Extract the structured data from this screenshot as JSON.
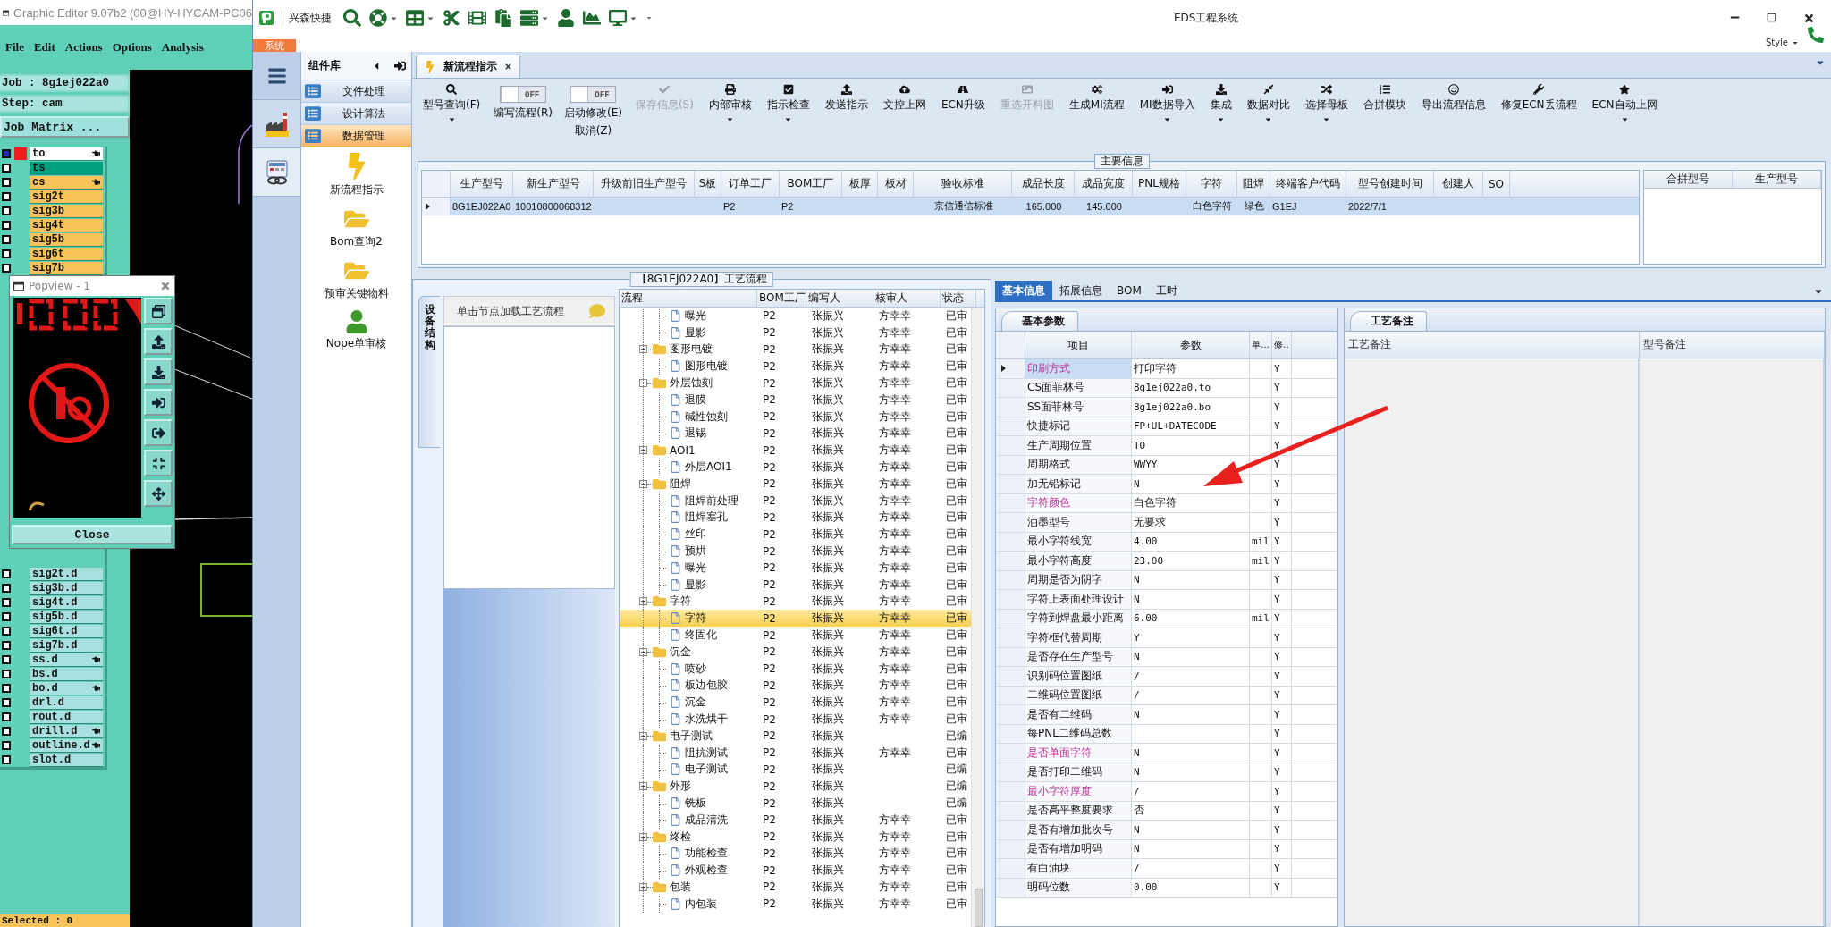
{
  "graphic_editor": {
    "title": "Graphic Editor 9.07b2 (00@HY-HYCAM-PC06",
    "menu": [
      "File",
      "Edit",
      "Actions",
      "Options",
      "Analysis"
    ],
    "job": "Job : 8g1ej022a0",
    "step": "Step: cam",
    "job_matrix_button": "Job Matrix ...",
    "layers_upper": [
      {
        "name": "to",
        "color": "#ffffff",
        "active": true,
        "marked": true
      },
      {
        "name": "ts",
        "color": "#00a07c",
        "active": false,
        "marked": false
      },
      {
        "name": "cs",
        "color": "#f8c25a",
        "active": false,
        "marked": true
      },
      {
        "name": "sig2t",
        "color": "#f8c25a",
        "active": false,
        "marked": false
      },
      {
        "name": "sig3b",
        "color": "#f8c25a",
        "active": false,
        "marked": false
      },
      {
        "name": "sig4t",
        "color": "#f8c25a",
        "active": false,
        "marked": false
      },
      {
        "name": "sig5b",
        "color": "#f8c25a",
        "active": false,
        "marked": false
      },
      {
        "name": "sig6t",
        "color": "#f8c25a",
        "active": false,
        "marked": false
      },
      {
        "name": "sig7b",
        "color": "#f8c25a",
        "active": false,
        "marked": false
      }
    ],
    "layers_lower": [
      {
        "name": "sig2t.d",
        "color": "#a8e0e0",
        "active": false,
        "marked": false
      },
      {
        "name": "sig3b.d",
        "color": "#a8e0e0",
        "active": false,
        "marked": false
      },
      {
        "name": "sig4t.d",
        "color": "#a8e0e0",
        "active": false,
        "marked": false
      },
      {
        "name": "sig5b.d",
        "color": "#a8e0e0",
        "active": false,
        "marked": false
      },
      {
        "name": "sig6t.d",
        "color": "#a8e0e0",
        "active": false,
        "marked": false
      },
      {
        "name": "sig7b.d",
        "color": "#a8e0e0",
        "active": false,
        "marked": false
      },
      {
        "name": "ss.d",
        "color": "#a8e0e0",
        "active": false,
        "marked": true
      },
      {
        "name": "bs.d",
        "color": "#a8e0e0",
        "active": false,
        "marked": false
      },
      {
        "name": "bo.d",
        "color": "#a8e0e0",
        "active": false,
        "marked": true
      },
      {
        "name": "drl.d",
        "color": "#a8e0e0",
        "active": false,
        "marked": false
      },
      {
        "name": "rout.d",
        "color": "#a8e0e0",
        "active": false,
        "marked": false
      },
      {
        "name": "drill.d",
        "color": "#a8e0e0",
        "active": false,
        "marked": true
      },
      {
        "name": "outline.d",
        "color": "#a8e0e0",
        "active": false,
        "marked": true
      },
      {
        "name": "slot.d",
        "color": "#a8e0e0",
        "active": false,
        "marked": false
      }
    ],
    "status": "Selected : 0",
    "popview": {
      "title": "Popview - 1",
      "close_button": "Close"
    }
  },
  "eds": {
    "app_name": "兴森快捷",
    "title": "EDS工程系统",
    "system_tab": "系统",
    "style_menu": "Style",
    "component_library": {
      "title": "组件库",
      "categories": [
        {
          "label": "文件处理",
          "selected": false
        },
        {
          "label": "设计算法",
          "selected": false
        },
        {
          "label": "数据管理",
          "selected": true
        }
      ],
      "launchers": [
        {
          "label": "新流程指示",
          "kind": "lightning"
        },
        {
          "label": "Bom查询2",
          "kind": "folder"
        },
        {
          "label": "预审关键物料",
          "kind": "folder"
        },
        {
          "label": "Nope单审核",
          "kind": "person"
        }
      ]
    },
    "doc_tabs": [
      {
        "label": "新流程指示",
        "selected": true
      }
    ],
    "toolbar": [
      {
        "kind": "button",
        "label": "型号查询(F)",
        "dropdown": true,
        "disabled": false
      },
      {
        "kind": "toggle",
        "label": "编写流程(R)",
        "state_text": "OFF",
        "on": false
      },
      {
        "kind": "toggle",
        "label": "启动修改(E)",
        "sublabel": "取消(Z)",
        "state_text": "OFF",
        "on": false
      },
      {
        "kind": "button",
        "label": "保存信息(S)",
        "dropdown": false,
        "disabled": true
      },
      {
        "kind": "button",
        "label": "内部审核",
        "dropdown": true,
        "disabled": false
      },
      {
        "kind": "button",
        "label": "指示检查",
        "dropdown": true,
        "disabled": false
      },
      {
        "kind": "button",
        "label": "发送指示",
        "dropdown": false,
        "disabled": false
      },
      {
        "kind": "button",
        "label": "文控上网",
        "dropdown": false,
        "disabled": false
      },
      {
        "kind": "button",
        "label": "ECN升级",
        "dropdown": false,
        "disabled": false
      },
      {
        "kind": "button",
        "label": "重选开料图",
        "dropdown": false,
        "disabled": true
      },
      {
        "kind": "button",
        "label": "生成MI流程",
        "dropdown": false,
        "disabled": false
      },
      {
        "kind": "button",
        "label": "MI数据导入",
        "dropdown": true,
        "disabled": false
      },
      {
        "kind": "button",
        "label": "集成",
        "dropdown": true,
        "disabled": false
      },
      {
        "kind": "button",
        "label": "数据对比",
        "dropdown": true,
        "disabled": false
      },
      {
        "kind": "button",
        "label": "选择母板",
        "dropdown": true,
        "disabled": false
      },
      {
        "kind": "button",
        "label": "合拼模块",
        "dropdown": false,
        "disabled": false
      },
      {
        "kind": "button",
        "label": "导出流程信息",
        "dropdown": false,
        "disabled": false
      },
      {
        "kind": "button",
        "label": "修复ECN丢流程",
        "dropdown": false,
        "disabled": false
      },
      {
        "kind": "button",
        "label": "ECN自动上网",
        "dropdown": true,
        "disabled": false
      }
    ],
    "main_info": {
      "legend": "主要信息",
      "columns": [
        "生产型号",
        "新生产型号",
        "升级前旧生产型号",
        "S板",
        "订单工厂",
        "BOM工厂",
        "板厚",
        "板材",
        "验收标准",
        "成品长度",
        "成品宽度",
        "PNL规格",
        "字符",
        "阻焊",
        "终端客户代码",
        "型号创建时间",
        "创建人",
        "SO"
      ],
      "rows": [
        {
          "current": true,
          "selected": true,
          "cells": [
            "8G1EJ022A0",
            "10010800068312",
            null,
            null,
            "P2",
            "P2",
            null,
            null,
            "京信通信标准",
            "165.000",
            "145.000",
            null,
            "白色字符",
            "绿色",
            "G1EJ",
            "2022/7/1",
            null,
            null
          ]
        }
      ],
      "side_columns": [
        "合拼型号",
        "生产型号"
      ]
    },
    "process_flow": {
      "legend": "【8G1EJ022A0】工艺流程",
      "side_tab": "设备结构",
      "hint": "单击节点加载工艺流程",
      "columns": [
        "流程",
        "BOM工厂",
        "编写人",
        "核审人",
        "状态"
      ],
      "rows": [
        {
          "kind": "step",
          "label": "曝光",
          "bom": "P2",
          "writer": "张振兴",
          "reviewer": "方幸幸",
          "status": "已审",
          "selected": false
        },
        {
          "kind": "step",
          "label": "显影",
          "bom": "P2",
          "writer": "张振兴",
          "reviewer": "方幸幸",
          "status": "已审",
          "selected": false
        },
        {
          "kind": "group",
          "label": "图形电镀",
          "bom": "P2",
          "writer": "张振兴",
          "reviewer": "方幸幸",
          "status": "已审",
          "selected": false,
          "expanded": true,
          "children": [
            {
              "kind": "step",
              "label": "图形电镀",
              "bom": "P2",
              "writer": "张振兴",
              "reviewer": "方幸幸",
              "status": "已审",
              "selected": false
            }
          ]
        },
        {
          "kind": "group",
          "label": "外层蚀刻",
          "bom": "P2",
          "writer": "张振兴",
          "reviewer": "方幸幸",
          "status": "已审",
          "selected": false,
          "expanded": true,
          "children": [
            {
              "kind": "step",
              "label": "退膜",
              "bom": "P2",
              "writer": "张振兴",
              "reviewer": "方幸幸",
              "status": "已审",
              "selected": false
            },
            {
              "kind": "step",
              "label": "碱性蚀刻",
              "bom": "P2",
              "writer": "张振兴",
              "reviewer": "方幸幸",
              "status": "已审",
              "selected": false
            },
            {
              "kind": "step",
              "label": "退锡",
              "bom": "P2",
              "writer": "张振兴",
              "reviewer": "方幸幸",
              "status": "已审",
              "selected": false
            }
          ]
        },
        {
          "kind": "group",
          "label": "AOI1",
          "bom": "P2",
          "writer": "张振兴",
          "reviewer": "方幸幸",
          "status": "已审",
          "selected": false,
          "expanded": true,
          "children": [
            {
              "kind": "step",
              "label": "外层AOI1",
              "bom": "P2",
              "writer": "张振兴",
              "reviewer": "方幸幸",
              "status": "已审",
              "selected": false
            }
          ]
        },
        {
          "kind": "group",
          "label": "阻焊",
          "bom": "P2",
          "writer": "张振兴",
          "reviewer": "方幸幸",
          "status": "已审",
          "selected": false,
          "expanded": true,
          "children": [
            {
              "kind": "step",
              "label": "阻焊前处理",
              "bom": "P2",
              "writer": "张振兴",
              "reviewer": "方幸幸",
              "status": "已审",
              "selected": false
            },
            {
              "kind": "step",
              "label": "阻焊塞孔",
              "bom": "P2",
              "writer": "张振兴",
              "reviewer": "方幸幸",
              "status": "已审",
              "selected": false
            },
            {
              "kind": "step",
              "label": "丝印",
              "bom": "P2",
              "writer": "张振兴",
              "reviewer": "方幸幸",
              "status": "已审",
              "selected": false
            },
            {
              "kind": "step",
              "label": "预烘",
              "bom": "P2",
              "writer": "张振兴",
              "reviewer": "方幸幸",
              "status": "已审",
              "selected": false
            },
            {
              "kind": "step",
              "label": "曝光",
              "bom": "P2",
              "writer": "张振兴",
              "reviewer": "方幸幸",
              "status": "已审",
              "selected": false
            },
            {
              "kind": "step",
              "label": "显影",
              "bom": "P2",
              "writer": "张振兴",
              "reviewer": "方幸幸",
              "status": "已审",
              "selected": false
            }
          ]
        },
        {
          "kind": "group",
          "label": "字符",
          "bom": "P2",
          "writer": "张振兴",
          "reviewer": "方幸幸",
          "status": "已审",
          "selected": false,
          "expanded": true,
          "children": [
            {
              "kind": "step",
              "label": "字符",
              "bom": "P2",
              "writer": "张振兴",
              "reviewer": "方幸幸",
              "status": "已审",
              "selected": true
            },
            {
              "kind": "step",
              "label": "终固化",
              "bom": "P2",
              "writer": "张振兴",
              "reviewer": "方幸幸",
              "status": "已审",
              "selected": false
            }
          ]
        },
        {
          "kind": "group",
          "label": "沉金",
          "bom": "P2",
          "writer": "张振兴",
          "reviewer": "方幸幸",
          "status": "已审",
          "selected": false,
          "expanded": true,
          "children": [
            {
              "kind": "step",
              "label": "喷砂",
              "bom": "P2",
              "writer": "张振兴",
              "reviewer": "方幸幸",
              "status": "已审",
              "selected": false
            },
            {
              "kind": "step",
              "label": "板边包胶",
              "bom": "P2",
              "writer": "张振兴",
              "reviewer": "方幸幸",
              "status": "已审",
              "selected": false
            },
            {
              "kind": "step",
              "label": "沉金",
              "bom": "P2",
              "writer": "张振兴",
              "reviewer": "方幸幸",
              "status": "已审",
              "selected": false
            },
            {
              "kind": "step",
              "label": "水洗烘干",
              "bom": "P2",
              "writer": "张振兴",
              "reviewer": "方幸幸",
              "status": "已审",
              "selected": false
            }
          ]
        },
        {
          "kind": "group",
          "label": "电子测试",
          "bom": "P2",
          "writer": "张振兴",
          "status": "已编",
          "selected": false,
          "expanded": true,
          "children": [
            {
              "kind": "step",
              "label": "阻抗测试",
              "bom": "P2",
              "writer": "张振兴",
              "reviewer": "方幸幸",
              "status": "已审",
              "selected": false
            },
            {
              "kind": "step",
              "label": "电子测试",
              "bom": "P2",
              "writer": "张振兴",
              "status": "已编",
              "selected": false
            }
          ]
        },
        {
          "kind": "group",
          "label": "外形",
          "bom": "P2",
          "writer": "张振兴",
          "status": "已编",
          "selected": false,
          "expanded": true,
          "children": [
            {
              "kind": "step",
              "label": "铣板",
              "bom": "P2",
              "writer": "张振兴",
              "status": "已编",
              "selected": false
            },
            {
              "kind": "step",
              "label": "成品清洗",
              "bom": "P2",
              "writer": "张振兴",
              "reviewer": "方幸幸",
              "status": "已审",
              "selected": false
            }
          ]
        },
        {
          "kind": "group",
          "label": "终检",
          "bom": "P2",
          "writer": "张振兴",
          "reviewer": "方幸幸",
          "status": "已审",
          "selected": false,
          "expanded": true,
          "children": [
            {
              "kind": "step",
              "label": "功能检查",
              "bom": "P2",
              "writer": "张振兴",
              "reviewer": "方幸幸",
              "status": "已审",
              "selected": false
            },
            {
              "kind": "step",
              "label": "外观检查",
              "bom": "P2",
              "writer": "张振兴",
              "reviewer": "方幸幸",
              "status": "已审",
              "selected": false
            }
          ]
        },
        {
          "kind": "group",
          "label": "包装",
          "bom": "P2",
          "writer": "张振兴",
          "reviewer": "方幸幸",
          "status": "已审",
          "selected": false,
          "expanded": true,
          "children": [
            {
              "kind": "step",
              "label": "内包装",
              "bom": "P2",
              "writer": "张振兴",
              "reviewer": "方幸幸",
              "status": "已审",
              "selected": false
            }
          ]
        }
      ]
    },
    "detail_tabs": [
      {
        "label": "基本信息",
        "selected": true
      },
      {
        "label": "拓展信息",
        "selected": false
      },
      {
        "label": "BOM",
        "selected": false
      },
      {
        "label": "工时",
        "selected": false
      }
    ],
    "params": {
      "tab": "基本参数",
      "columns": [
        "项目",
        "参数",
        "单...",
        "修.."
      ],
      "rows": [
        {
          "item": "印刷方式",
          "value": "打印字符",
          "flag": "Y",
          "highlighted": true,
          "current": true
        },
        {
          "item": "CS面菲林号",
          "value": "8g1ej022a0.to",
          "flag": "Y",
          "highlighted": false,
          "current": false
        },
        {
          "item": "SS面菲林号",
          "value": "8g1ej022a0.bo",
          "flag": "Y",
          "highlighted": false,
          "current": false
        },
        {
          "item": "快捷标记",
          "value": "FP+UL+DATECODE",
          "flag": "Y",
          "highlighted": false,
          "current": false
        },
        {
          "item": "生产周期位置",
          "value": "TO",
          "flag": "Y",
          "highlighted": false,
          "current": false
        },
        {
          "item": "周期格式",
          "value": "WWYY",
          "flag": "Y",
          "highlighted": false,
          "current": false
        },
        {
          "item": "加无铅标记",
          "value": "N",
          "flag": "Y",
          "highlighted": false,
          "current": false
        },
        {
          "item": "字符颜色",
          "value": "白色字符",
          "flag": "Y",
          "highlighted": true,
          "current": false
        },
        {
          "item": "油墨型号",
          "value": "无要求",
          "flag": "Y",
          "highlighted": false,
          "current": false
        },
        {
          "item": "最小字符线宽",
          "value": "4.00",
          "unit": "mil",
          "flag": "Y",
          "highlighted": false,
          "current": false
        },
        {
          "item": "最小字符高度",
          "value": "23.00",
          "unit": "mil",
          "flag": "Y",
          "highlighted": false,
          "current": false
        },
        {
          "item": "周期是否为阴字",
          "value": "N",
          "flag": "Y",
          "highlighted": false,
          "current": false
        },
        {
          "item": "字符上表面处理设计",
          "value": "N",
          "flag": "Y",
          "highlighted": false,
          "current": false
        },
        {
          "item": "字符到焊盘最小距离",
          "value": "6.00",
          "unit": "mil",
          "flag": "Y",
          "highlighted": false,
          "current": false
        },
        {
          "item": "字符框代替周期",
          "value": "Y",
          "flag": "Y",
          "highlighted": false,
          "current": false
        },
        {
          "item": "是否存在生产型号",
          "value": "N",
          "flag": "Y",
          "highlighted": false,
          "current": false
        },
        {
          "item": "识别码位置图纸",
          "value": "/",
          "flag": "Y",
          "highlighted": false,
          "current": false
        },
        {
          "item": "二维码位置图纸",
          "value": "/",
          "flag": "Y",
          "highlighted": false,
          "current": false
        },
        {
          "item": "是否有二维码",
          "value": "N",
          "flag": "Y",
          "highlighted": false,
          "current": false
        },
        {
          "item": "每PNL二维码总数",
          "flag": "Y",
          "highlighted": false,
          "current": false
        },
        {
          "item": "是否单面字符",
          "value": "N",
          "flag": "Y",
          "highlighted": true,
          "current": false
        },
        {
          "item": "是否打印二维码",
          "value": "N",
          "flag": "Y",
          "highlighted": false,
          "current": false
        },
        {
          "item": "最小字符厚度",
          "value": "/",
          "flag": "Y",
          "highlighted": true,
          "current": false
        },
        {
          "item": "是否高平整度要求",
          "value": "否",
          "flag": "Y",
          "highlighted": false,
          "current": false
        },
        {
          "item": "是否有增加批次号",
          "value": "N",
          "flag": "Y",
          "highlighted": false,
          "current": false
        },
        {
          "item": "是否有增加明码",
          "value": "N",
          "flag": "Y",
          "highlighted": false,
          "current": false
        },
        {
          "item": "有白油块",
          "value": "/",
          "flag": "Y",
          "highlighted": false,
          "current": false
        },
        {
          "item": "明码位数",
          "value": "0.00",
          "flag": "Y",
          "highlighted": false,
          "current": false
        }
      ]
    },
    "notes": {
      "tab": "工艺备注",
      "columns": [
        "工艺备注",
        "型号备注"
      ]
    }
  }
}
